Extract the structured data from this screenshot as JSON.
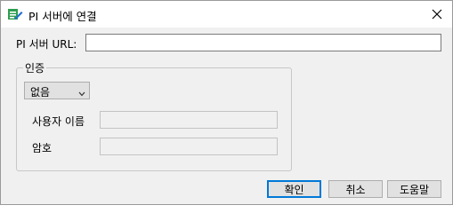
{
  "window": {
    "title": "PI 서버에 연결",
    "icon": "pi-connect-icon",
    "close_icon": "close-icon"
  },
  "server": {
    "url_label": "PI 서버 URL:",
    "url_value": ""
  },
  "auth": {
    "group_label": "인증",
    "method_value": "없음",
    "username_label": "사용자 이름",
    "username_value": "",
    "password_label": "암호",
    "password_value": ""
  },
  "buttons": {
    "ok": "확인",
    "cancel": "취소",
    "help": "도움말"
  },
  "colors": {
    "icon_green": "#2e9e4f",
    "icon_blue": "#1f6fd1",
    "default_button_border": "#0078d7"
  }
}
